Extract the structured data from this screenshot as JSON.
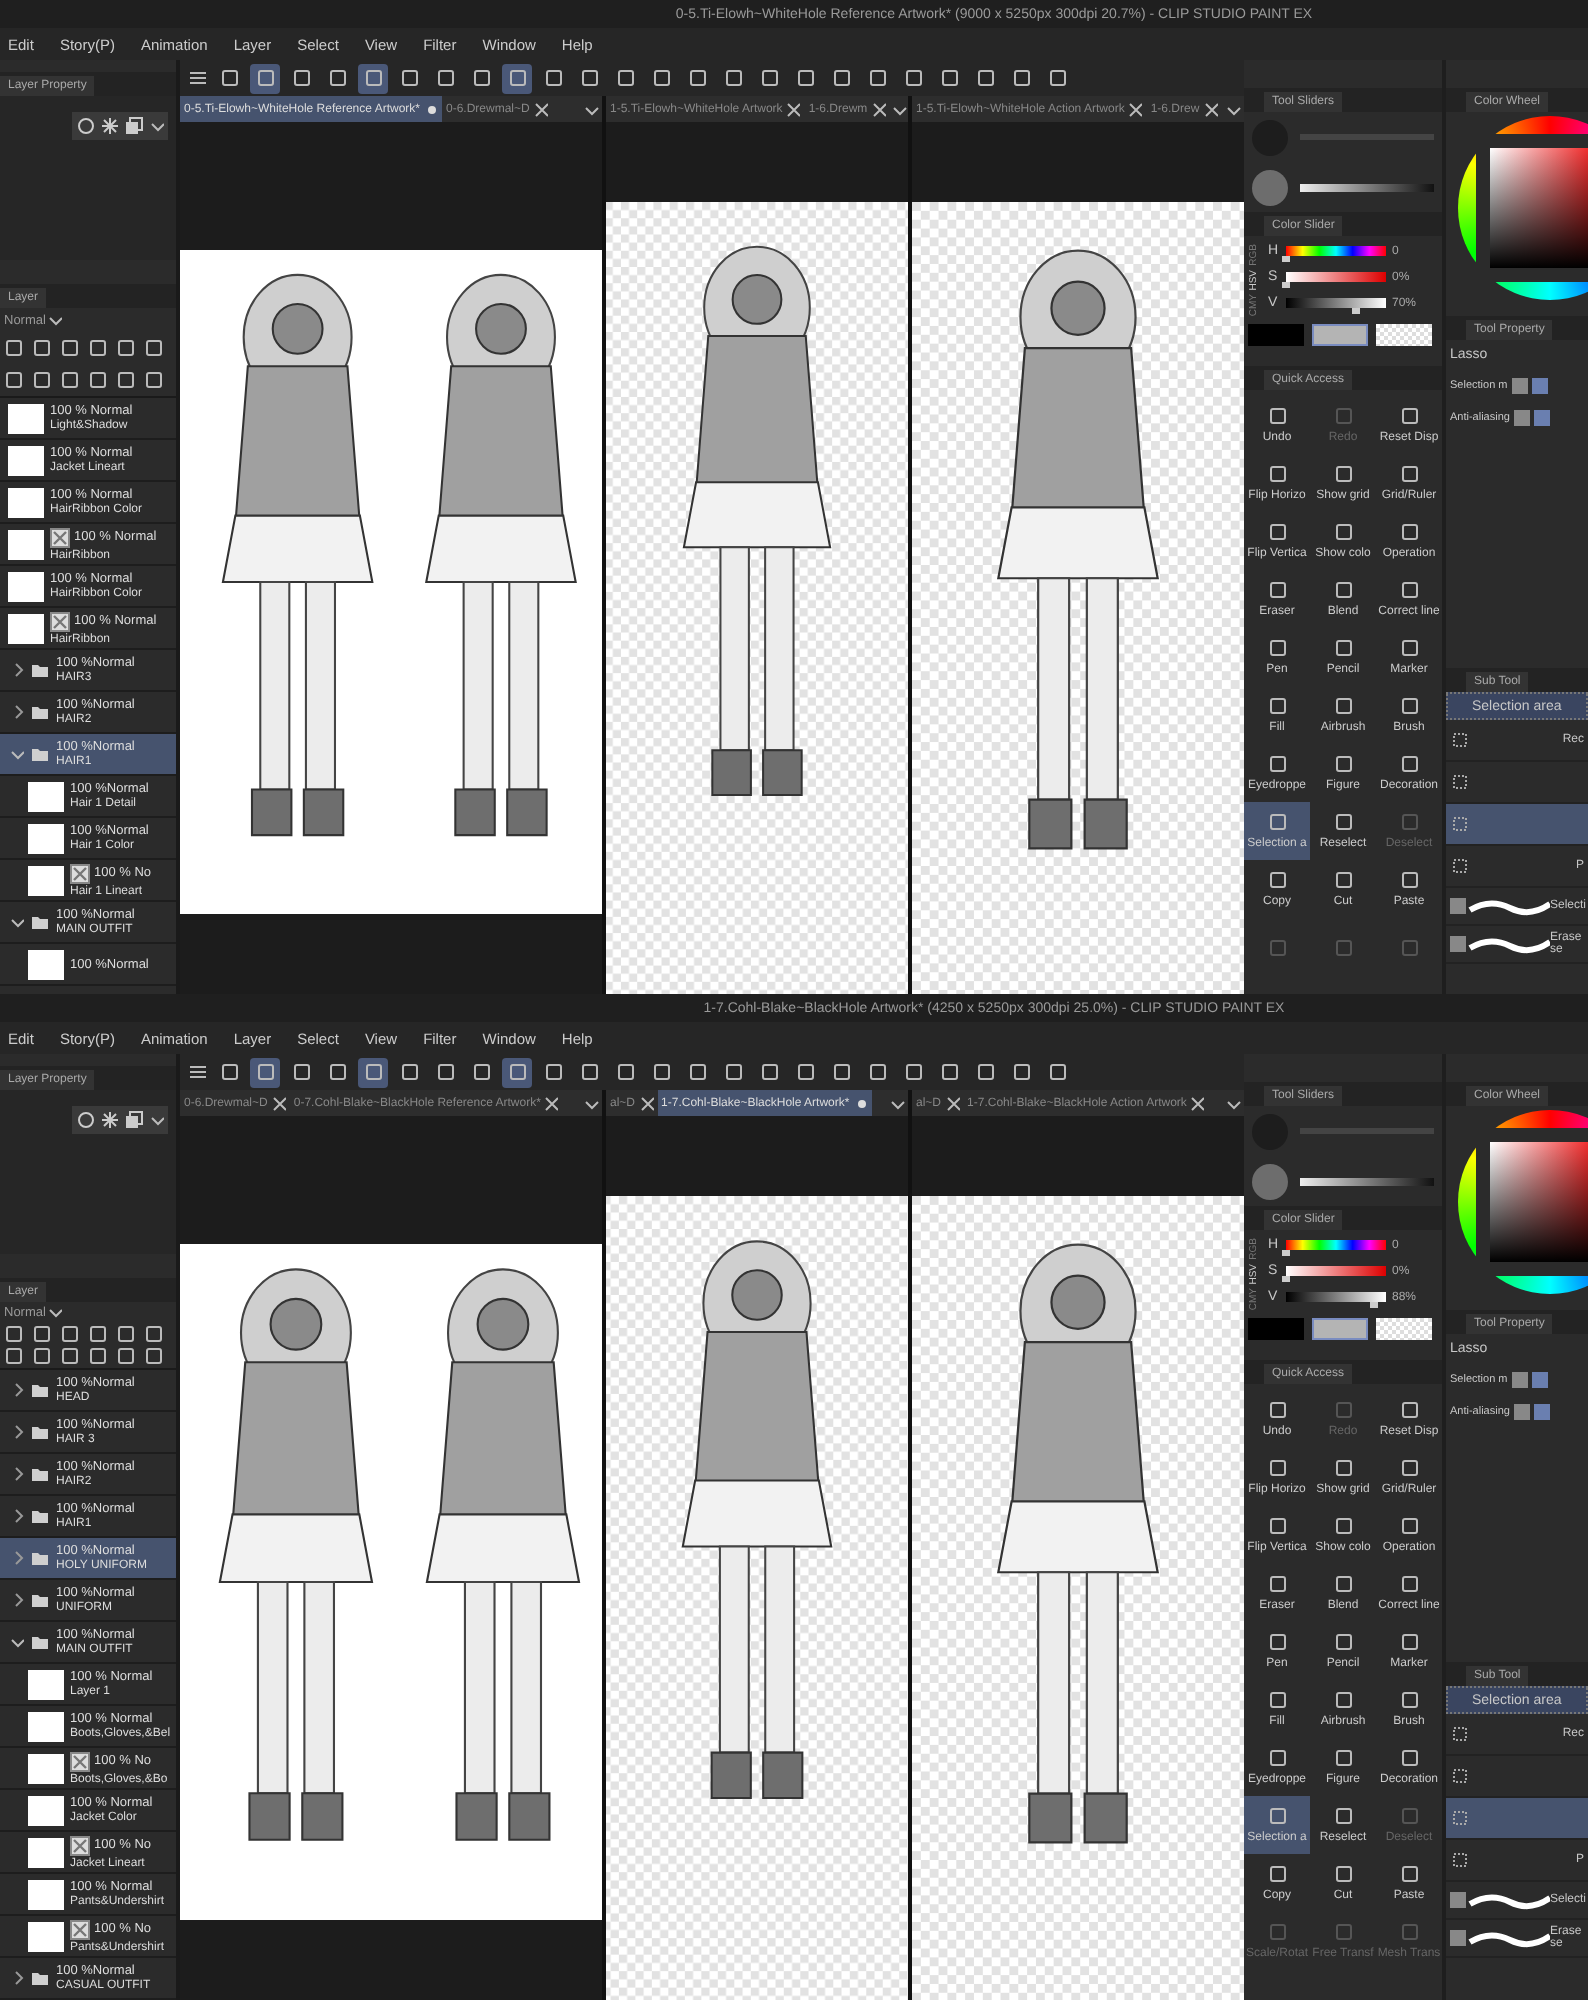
{
  "windows": [
    {
      "title": "0-5.Ti-Elowh~WhiteHole Reference Artwork* (9000 x 5250px 300dpi 20.7%) - CLIP STUDIO PAINT EX",
      "menu": [
        "Edit",
        "Story(P)",
        "Animation",
        "Layer",
        "Select",
        "View",
        "Filter",
        "Window",
        "Help"
      ],
      "toolbar": [
        {
          "selected": false
        },
        {
          "selected": true
        },
        {
          "selected": false
        },
        {
          "selected": false
        },
        {
          "selected": true
        },
        {
          "selected": false
        },
        {
          "selected": false
        },
        {
          "selected": false
        },
        {
          "selected": true
        },
        {
          "selected": false
        },
        {
          "selected": false
        },
        {
          "selected": false
        },
        {
          "selected": false
        },
        {
          "selected": false
        },
        {
          "selected": false
        },
        {
          "selected": false
        },
        {
          "selected": false
        },
        {
          "selected": false
        },
        {
          "selected": false
        },
        {
          "selected": false
        },
        {
          "selected": false
        },
        {
          "selected": false
        },
        {
          "selected": false
        },
        {
          "selected": false
        }
      ],
      "layer_property": "Layer Property",
      "layer_panel": {
        "title": "Layer",
        "blend_mode": "Normal",
        "layers": [
          {
            "kind": "layer",
            "status": "100 % Normal",
            "name": "Light&Shadow",
            "selected": false
          },
          {
            "kind": "layer",
            "status": "100 % Normal",
            "name": "Jacket Lineart",
            "selected": false
          },
          {
            "kind": "layer",
            "status": "100 % Normal",
            "name": "HairRibbon Color",
            "selected": false
          },
          {
            "kind": "mask",
            "status": "100 % Normal",
            "name": "HairRibbon",
            "selected": false
          },
          {
            "kind": "layer",
            "status": "100 % Normal",
            "name": "HairRibbon Color",
            "selected": false
          },
          {
            "kind": "mask",
            "status": "100 % Normal",
            "name": "HairRibbon",
            "selected": false
          },
          {
            "kind": "folder",
            "status": "100 %Normal",
            "name": "HAIR3",
            "selected": false,
            "expanded": false
          },
          {
            "kind": "folder",
            "status": "100 %Normal",
            "name": "HAIR2",
            "selected": false,
            "expanded": false
          },
          {
            "kind": "folder",
            "status": "100 %Normal",
            "name": "HAIR1",
            "selected": true,
            "expanded": true,
            "children": [
              {
                "kind": "layer",
                "status": "100 %Normal",
                "name": "Hair 1 Detail",
                "selected": false
              },
              {
                "kind": "layer",
                "status": "100 %Normal",
                "name": "Hair 1 Color",
                "selected": false
              },
              {
                "kind": "mask",
                "status": "100 % No",
                "name": "Hair 1 Lineart",
                "selected": false
              }
            ]
          },
          {
            "kind": "folder",
            "status": "100 %Normal",
            "name": "MAIN OUTFIT",
            "selected": false,
            "expanded": true,
            "children": [
              {
                "kind": "layer",
                "status": "100 %Normal",
                "selected": false
              }
            ]
          }
        ]
      },
      "panes": [
        {
          "kind": "reference",
          "tabs": [
            {
              "label": "0-5.Ti-Elowh~WhiteHole Reference Artwork*",
              "selected": true
            },
            {
              "label": "0-6.Drewmal~D",
              "selected": false
            }
          ]
        },
        {
          "kind": "sheet",
          "tabs": [
            {
              "label": "1-5.Ti-Elowh~WhiteHole Artwork",
              "selected": false
            },
            {
              "label": "1-6.Drewm",
              "selected": false
            }
          ]
        },
        {
          "kind": "sheet",
          "tabs": [
            {
              "label": "1-5.Ti-Elowh~WhiteHole Action Artwork",
              "selected": false
            },
            {
              "label": "1-6.Drew",
              "selected": false
            }
          ]
        }
      ],
      "tool_sliders": "Tool Sliders",
      "color_wheel": "Color Wheel",
      "color_slider": {
        "title": "Color Slider",
        "modes": [
          {
            "label": "CMY",
            "selected": false
          },
          {
            "label": "HSV",
            "selected": true
          },
          {
            "label": "RGB",
            "selected": false
          }
        ],
        "channels": [
          {
            "label": "H",
            "reading": "0",
            "level": 0
          },
          {
            "label": "S",
            "reading": "0%",
            "level": 0
          },
          {
            "label": "V",
            "reading": "70%",
            "level": 0.7
          }
        ]
      },
      "quick_access": {
        "title": "Quick Access",
        "items": [
          {
            "label": "Undo",
            "selected": false,
            "disabled": false
          },
          {
            "label": "Redo",
            "selected": false,
            "disabled": true
          },
          {
            "label": "Reset Disp",
            "selected": false,
            "disabled": false
          },
          {
            "label": "Flip Horizo",
            "selected": false,
            "disabled": false
          },
          {
            "label": "Show grid",
            "selected": false,
            "disabled": false
          },
          {
            "label": "Grid/Ruler",
            "selected": false,
            "disabled": false
          },
          {
            "label": "Flip Vertica",
            "selected": false,
            "disabled": false
          },
          {
            "label": "Show colo",
            "selected": false,
            "disabled": false
          },
          {
            "label": "Operation",
            "selected": false,
            "disabled": false
          },
          {
            "label": "Eraser",
            "selected": false,
            "disabled": false
          },
          {
            "label": "Blend",
            "selected": false,
            "disabled": false
          },
          {
            "label": "Correct line",
            "selected": false,
            "disabled": false
          },
          {
            "label": "Pen",
            "selected": false,
            "disabled": false
          },
          {
            "label": "Pencil",
            "selected": false,
            "disabled": false
          },
          {
            "label": "Marker",
            "selected": false,
            "disabled": false
          },
          {
            "label": "Fill",
            "selected": false,
            "disabled": false
          },
          {
            "label": "Airbrush",
            "selected": false,
            "disabled": false
          },
          {
            "label": "Brush",
            "selected": false,
            "disabled": false
          },
          {
            "label": "Eyedroppe",
            "selected": false,
            "disabled": false
          },
          {
            "label": "Figure",
            "selected": false,
            "disabled": false
          },
          {
            "label": "Decoration",
            "selected": false,
            "disabled": false
          },
          {
            "label": "Selection a",
            "selected": true,
            "disabled": false
          },
          {
            "label": "Reselect",
            "selected": false,
            "disabled": false
          },
          {
            "label": "Deselect",
            "selected": false,
            "disabled": true
          },
          {
            "label": "Copy",
            "selected": false,
            "disabled": false
          },
          {
            "label": "Cut",
            "selected": false,
            "disabled": false
          },
          {
            "label": "Paste",
            "selected": false,
            "disabled": false
          },
          {
            "selected": false,
            "disabled": true
          },
          {
            "selected": false,
            "disabled": true
          },
          {
            "selected": false,
            "disabled": true
          }
        ]
      },
      "tool_property": {
        "title": "Tool Property",
        "tool": "Lasso",
        "settings": [
          "Selection m",
          "Anti-aliasing"
        ]
      },
      "sub_tool": {
        "title": "Sub Tool",
        "group": "Selection area",
        "items": [
          {
            "kind": "shape",
            "label": "Rec",
            "selected": false
          },
          {
            "kind": "shape",
            "selected": false
          },
          {
            "kind": "shape",
            "selected": true
          },
          {
            "kind": "shape",
            "label": "P",
            "selected": false
          },
          {
            "kind": "brush",
            "label": "Selecti",
            "selected": false
          },
          {
            "kind": "brush",
            "label": "Erase se",
            "selected": false
          }
        ]
      }
    },
    {
      "title": "1-7.Cohl-Blake~BlackHole Artwork* (4250 x 5250px 300dpi 25.0%) - CLIP STUDIO PAINT EX",
      "menu": [
        "Edit",
        "Story(P)",
        "Animation",
        "Layer",
        "Select",
        "View",
        "Filter",
        "Window",
        "Help"
      ],
      "toolbar": [
        {
          "selected": false
        },
        {
          "selected": true
        },
        {
          "selected": false
        },
        {
          "selected": false
        },
        {
          "selected": true
        },
        {
          "selected": false
        },
        {
          "selected": false
        },
        {
          "selected": false
        },
        {
          "selected": true
        },
        {
          "selected": false
        },
        {
          "selected": false
        },
        {
          "selected": false
        },
        {
          "selected": false
        },
        {
          "selected": false
        },
        {
          "selected": false
        },
        {
          "selected": false
        },
        {
          "selected": false
        },
        {
          "selected": false
        },
        {
          "selected": false
        },
        {
          "selected": false
        },
        {
          "selected": false
        },
        {
          "selected": false
        },
        {
          "selected": false
        },
        {
          "selected": false
        }
      ],
      "layer_property": "Layer Property",
      "layer_panel": {
        "title": "Layer",
        "blend_mode": "Normal",
        "layers": [
          {
            "kind": "folder",
            "status": "100 %Normal",
            "name": "HEAD",
            "selected": false,
            "expanded": false
          },
          {
            "kind": "folder",
            "status": "100 %Normal",
            "name": "HAIR 3",
            "selected": false,
            "expanded": false
          },
          {
            "kind": "folder",
            "status": "100 %Normal",
            "name": "HAIR2",
            "selected": false,
            "expanded": false
          },
          {
            "kind": "folder",
            "status": "100 %Normal",
            "name": "HAIR1",
            "selected": false,
            "expanded": false
          },
          {
            "kind": "folder",
            "status": "100 %Normal",
            "name": "HOLY UNIFORM",
            "selected": true,
            "expanded": false
          },
          {
            "kind": "folder",
            "status": "100 %Normal",
            "name": "UNIFORM",
            "selected": false,
            "expanded": false
          },
          {
            "kind": "folder",
            "status": "100 %Normal",
            "name": "MAIN OUTFIT",
            "selected": false,
            "expanded": true,
            "children": [
              {
                "kind": "layer",
                "status": "100 % Normal",
                "name": "Layer 1",
                "selected": false
              },
              {
                "kind": "layer",
                "status": "100 % Normal",
                "name": "Boots,Gloves,&Bel",
                "selected": false
              },
              {
                "kind": "mask",
                "status": "100 % No",
                "name": "Boots,Gloves,&Bo",
                "selected": false
              },
              {
                "kind": "layer",
                "status": "100 % Normal",
                "name": "Jacket Color",
                "selected": false
              },
              {
                "kind": "mask",
                "status": "100 % No",
                "name": "Jacket Lineart",
                "selected": false
              },
              {
                "kind": "layer",
                "status": "100 % Normal",
                "name": "Pants&Undershirt",
                "selected": false
              },
              {
                "kind": "mask",
                "status": "100 % No",
                "name": "Pants&Undershirt",
                "selected": false
              }
            ]
          },
          {
            "kind": "folder",
            "status": "100 %Normal",
            "name": "CASUAL OUTFIT",
            "selected": false,
            "expanded": false
          }
        ]
      },
      "panes": [
        {
          "kind": "reference",
          "tabs": [
            {
              "label": "0-6.Drewmal~D",
              "selected": false
            },
            {
              "label": "0-7.Cohl-Blake~BlackHole Reference Artwork*",
              "selected": false
            }
          ]
        },
        {
          "kind": "sheet",
          "tabs": [
            {
              "label": "al~D",
              "selected": false
            },
            {
              "label": "1-7.Cohl-Blake~BlackHole Artwork*",
              "selected": true
            }
          ]
        },
        {
          "kind": "sheet",
          "tabs": [
            {
              "label": "al~D",
              "selected": false
            },
            {
              "label": "1-7.Cohl-Blake~BlackHole Action Artwork",
              "selected": false
            }
          ]
        }
      ],
      "tool_sliders": "Tool Sliders",
      "color_wheel": "Color Wheel",
      "color_slider": {
        "title": "Color Slider",
        "modes": [
          {
            "label": "CMY",
            "selected": false
          },
          {
            "label": "HSV",
            "selected": true
          },
          {
            "label": "RGB",
            "selected": false
          }
        ],
        "channels": [
          {
            "label": "H",
            "reading": "0",
            "level": 0
          },
          {
            "label": "S",
            "reading": "0%",
            "level": 0
          },
          {
            "label": "V",
            "reading": "88%",
            "level": 0.88
          }
        ]
      },
      "quick_access": {
        "title": "Quick Access",
        "items": [
          {
            "label": "Undo",
            "selected": false,
            "disabled": false
          },
          {
            "label": "Redo",
            "selected": false,
            "disabled": true
          },
          {
            "label": "Reset Disp",
            "selected": false,
            "disabled": false
          },
          {
            "label": "Flip Horizo",
            "selected": false,
            "disabled": false
          },
          {
            "label": "Show grid",
            "selected": false,
            "disabled": false
          },
          {
            "label": "Grid/Ruler",
            "selected": false,
            "disabled": false
          },
          {
            "label": "Flip Vertica",
            "selected": false,
            "disabled": false
          },
          {
            "label": "Show colo",
            "selected": false,
            "disabled": false
          },
          {
            "label": "Operation",
            "selected": false,
            "disabled": false
          },
          {
            "label": "Eraser",
            "selected": false,
            "disabled": false
          },
          {
            "label": "Blend",
            "selected": false,
            "disabled": false
          },
          {
            "label": "Correct line",
            "selected": false,
            "disabled": false
          },
          {
            "label": "Pen",
            "selected": false,
            "disabled": false
          },
          {
            "label": "Pencil",
            "selected": false,
            "disabled": false
          },
          {
            "label": "Marker",
            "selected": false,
            "disabled": false
          },
          {
            "label": "Fill",
            "selected": false,
            "disabled": false
          },
          {
            "label": "Airbrush",
            "selected": false,
            "disabled": false
          },
          {
            "label": "Brush",
            "selected": false,
            "disabled": false
          },
          {
            "label": "Eyedroppe",
            "selected": false,
            "disabled": false
          },
          {
            "label": "Figure",
            "selected": false,
            "disabled": false
          },
          {
            "label": "Decoration",
            "selected": false,
            "disabled": false
          },
          {
            "label": "Selection a",
            "selected": true,
            "disabled": false
          },
          {
            "label": "Reselect",
            "selected": false,
            "disabled": false
          },
          {
            "label": "Deselect",
            "selected": false,
            "disabled": true
          },
          {
            "label": "Copy",
            "selected": false,
            "disabled": false
          },
          {
            "label": "Cut",
            "selected": false,
            "disabled": false
          },
          {
            "label": "Paste",
            "selected": false,
            "disabled": false
          },
          {
            "label": "Scale/Rotat",
            "selected": false,
            "disabled": true
          },
          {
            "label": "Free Transf",
            "selected": false,
            "disabled": true
          },
          {
            "label": "Mesh Trans",
            "selected": false,
            "disabled": true
          }
        ]
      },
      "tool_property": {
        "title": "Tool Property",
        "tool": "Lasso",
        "settings": [
          "Selection m",
          "Anti-aliasing"
        ]
      },
      "sub_tool": {
        "title": "Sub Tool",
        "group": "Selection area",
        "items": [
          {
            "kind": "shape",
            "label": "Rec",
            "selected": false
          },
          {
            "kind": "shape",
            "selected": false
          },
          {
            "kind": "shape",
            "selected": true
          },
          {
            "kind": "shape",
            "label": "P",
            "selected": false
          },
          {
            "kind": "brush",
            "label": "Selecti",
            "selected": false
          },
          {
            "kind": "brush",
            "label": "Erase se",
            "selected": false
          }
        ]
      }
    }
  ]
}
